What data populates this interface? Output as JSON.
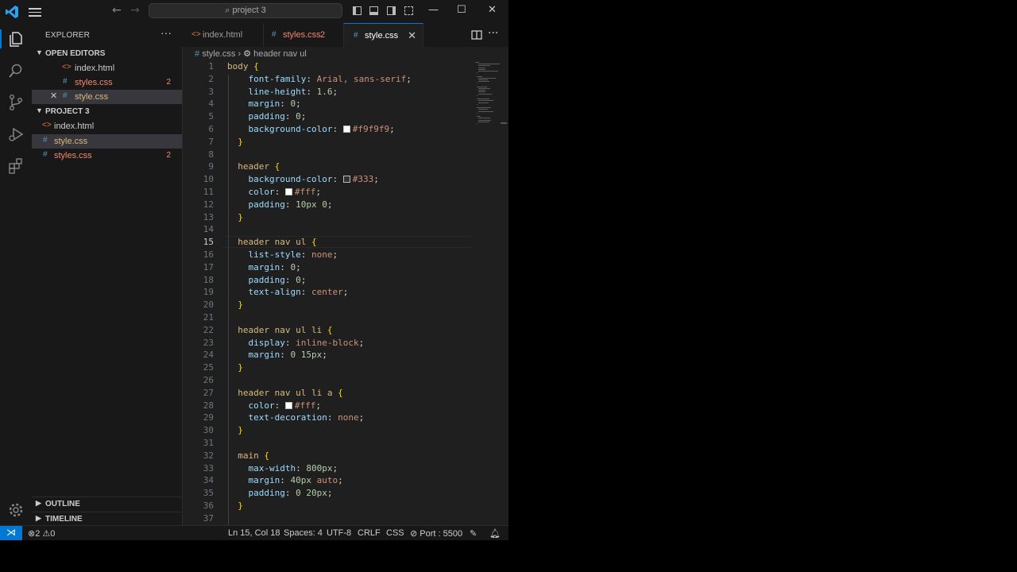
{
  "titlebar": {
    "search_text": "project 3",
    "back_arrow": "←",
    "forward_arrow": "→"
  },
  "sidebar": {
    "title": "EXPLORER",
    "more": "···",
    "open_editors_label": "OPEN EDITORS",
    "open_editors": [
      {
        "icon": "<>",
        "name": "index.html",
        "badge": ""
      },
      {
        "icon": "#",
        "name": "styles.css",
        "badge": "2"
      },
      {
        "icon": "#",
        "name": "style.css",
        "badge": "",
        "close": "✕"
      }
    ],
    "project_label": "PROJECT 3",
    "files": [
      {
        "icon": "<>",
        "name": "index.html",
        "badge": ""
      },
      {
        "icon": "#",
        "name": "style.css",
        "badge": ""
      },
      {
        "icon": "#",
        "name": "styles.css",
        "badge": "2"
      }
    ],
    "outline_label": "OUTLINE",
    "timeline_label": "TIMELINE"
  },
  "tabs": [
    {
      "icon": "<>",
      "name": "index.html",
      "extra": ""
    },
    {
      "icon": "#",
      "name": "styles.css",
      "extra": "2"
    },
    {
      "icon": "#",
      "name": "style.css",
      "extra": "✕"
    }
  ],
  "breadcrumb": {
    "file_icon": "#",
    "file": "style.css",
    "separator": "›",
    "symbol_icon": "⚙",
    "symbol": "header nav ul"
  },
  "editor": {
    "current_line": 15,
    "lines": [
      {
        "n": "1"
      },
      {
        "n": "2"
      },
      {
        "n": "3"
      },
      {
        "n": "4"
      },
      {
        "n": "5"
      },
      {
        "n": "6"
      },
      {
        "n": "7"
      },
      {
        "n": "8"
      },
      {
        "n": "9"
      },
      {
        "n": "10"
      },
      {
        "n": "11"
      },
      {
        "n": "12"
      },
      {
        "n": "13"
      },
      {
        "n": "14"
      },
      {
        "n": "15"
      },
      {
        "n": "16"
      },
      {
        "n": "17"
      },
      {
        "n": "18"
      },
      {
        "n": "19"
      },
      {
        "n": "20"
      },
      {
        "n": "21"
      },
      {
        "n": "22"
      },
      {
        "n": "23"
      },
      {
        "n": "24"
      },
      {
        "n": "25"
      },
      {
        "n": "26"
      },
      {
        "n": "27"
      },
      {
        "n": "28"
      },
      {
        "n": "29"
      },
      {
        "n": "30"
      },
      {
        "n": "31"
      },
      {
        "n": "32"
      },
      {
        "n": "33"
      },
      {
        "n": "34"
      },
      {
        "n": "35"
      },
      {
        "n": "36"
      },
      {
        "n": "37"
      }
    ],
    "code": [
      {
        "indent": "",
        "parts": [
          {
            "t": "body ",
            "c": "sel"
          },
          {
            "t": "{",
            "c": "br"
          }
        ]
      },
      {
        "indent": "    ",
        "parts": [
          {
            "t": "font-family",
            "c": "pr"
          },
          {
            "t": ": "
          },
          {
            "t": "Arial, sans-serif",
            "c": "vs"
          },
          {
            "t": ";"
          }
        ]
      },
      {
        "indent": "    ",
        "parts": [
          {
            "t": "line-height",
            "c": "pr"
          },
          {
            "t": ": "
          },
          {
            "t": "1.6",
            "c": "num"
          },
          {
            "t": ";"
          }
        ]
      },
      {
        "indent": "    ",
        "parts": [
          {
            "t": "margin",
            "c": "pr"
          },
          {
            "t": ": "
          },
          {
            "t": "0",
            "c": "num"
          },
          {
            "t": ";"
          }
        ]
      },
      {
        "indent": "    ",
        "parts": [
          {
            "t": "padding",
            "c": "pr"
          },
          {
            "t": ": "
          },
          {
            "t": "0",
            "c": "num"
          },
          {
            "t": ";"
          }
        ]
      },
      {
        "indent": "    ",
        "parts": [
          {
            "t": "background-color",
            "c": "pr"
          },
          {
            "t": ": "
          },
          {
            "swatch": "#f9f9f9"
          },
          {
            "t": "#f9f9f9",
            "c": "vs"
          },
          {
            "t": ";"
          }
        ]
      },
      {
        "indent": "  ",
        "parts": [
          {
            "t": "}",
            "c": "br"
          }
        ]
      },
      {
        "indent": "",
        "parts": []
      },
      {
        "indent": "  ",
        "parts": [
          {
            "t": "header ",
            "c": "sel"
          },
          {
            "t": "{",
            "c": "br"
          }
        ]
      },
      {
        "indent": "    ",
        "parts": [
          {
            "t": "background-color",
            "c": "pr"
          },
          {
            "t": ": "
          },
          {
            "swatch": "#333333"
          },
          {
            "t": "#333",
            "c": "vs"
          },
          {
            "t": ";"
          }
        ]
      },
      {
        "indent": "    ",
        "parts": [
          {
            "t": "color",
            "c": "pr"
          },
          {
            "t": ": "
          },
          {
            "swatch": "#ffffff"
          },
          {
            "t": "#fff",
            "c": "vs"
          },
          {
            "t": ";"
          }
        ]
      },
      {
        "indent": "    ",
        "parts": [
          {
            "t": "padding",
            "c": "pr"
          },
          {
            "t": ": "
          },
          {
            "t": "10px 0",
            "c": "num"
          },
          {
            "t": ";"
          }
        ]
      },
      {
        "indent": "  ",
        "parts": [
          {
            "t": "}",
            "c": "br"
          }
        ]
      },
      {
        "indent": "",
        "parts": []
      },
      {
        "indent": "  ",
        "parts": [
          {
            "t": "header nav ul ",
            "c": "sel"
          },
          {
            "t": "{",
            "c": "br"
          }
        ]
      },
      {
        "indent": "    ",
        "parts": [
          {
            "t": "list-style",
            "c": "pr"
          },
          {
            "t": ": "
          },
          {
            "t": "none",
            "c": "vs"
          },
          {
            "t": ";"
          }
        ]
      },
      {
        "indent": "    ",
        "parts": [
          {
            "t": "margin",
            "c": "pr"
          },
          {
            "t": ": "
          },
          {
            "t": "0",
            "c": "num"
          },
          {
            "t": ";"
          }
        ]
      },
      {
        "indent": "    ",
        "parts": [
          {
            "t": "padding",
            "c": "pr"
          },
          {
            "t": ": "
          },
          {
            "t": "0",
            "c": "num"
          },
          {
            "t": ";"
          }
        ]
      },
      {
        "indent": "    ",
        "parts": [
          {
            "t": "text-align",
            "c": "pr"
          },
          {
            "t": ": "
          },
          {
            "t": "center",
            "c": "vs"
          },
          {
            "t": ";"
          }
        ]
      },
      {
        "indent": "  ",
        "parts": [
          {
            "t": "}",
            "c": "br"
          }
        ]
      },
      {
        "indent": "",
        "parts": []
      },
      {
        "indent": "  ",
        "parts": [
          {
            "t": "header nav ul li ",
            "c": "sel"
          },
          {
            "t": "{",
            "c": "br"
          }
        ]
      },
      {
        "indent": "    ",
        "parts": [
          {
            "t": "display",
            "c": "pr"
          },
          {
            "t": ": "
          },
          {
            "t": "inline-block",
            "c": "vs"
          },
          {
            "t": ";"
          }
        ]
      },
      {
        "indent": "    ",
        "parts": [
          {
            "t": "margin",
            "c": "pr"
          },
          {
            "t": ": "
          },
          {
            "t": "0 15px",
            "c": "num"
          },
          {
            "t": ";"
          }
        ]
      },
      {
        "indent": "  ",
        "parts": [
          {
            "t": "}",
            "c": "br"
          }
        ]
      },
      {
        "indent": "",
        "parts": []
      },
      {
        "indent": "  ",
        "parts": [
          {
            "t": "header nav ul li a ",
            "c": "sel"
          },
          {
            "t": "{",
            "c": "br"
          }
        ]
      },
      {
        "indent": "    ",
        "parts": [
          {
            "t": "color",
            "c": "pr"
          },
          {
            "t": ": "
          },
          {
            "swatch": "#ffffff"
          },
          {
            "t": "#fff",
            "c": "vs"
          },
          {
            "t": ";"
          }
        ]
      },
      {
        "indent": "    ",
        "parts": [
          {
            "t": "text-decoration",
            "c": "pr"
          },
          {
            "t": ": "
          },
          {
            "t": "none",
            "c": "vs"
          },
          {
            "t": ";"
          }
        ]
      },
      {
        "indent": "  ",
        "parts": [
          {
            "t": "}",
            "c": "br"
          }
        ]
      },
      {
        "indent": "",
        "parts": []
      },
      {
        "indent": "  ",
        "parts": [
          {
            "t": "main ",
            "c": "sel"
          },
          {
            "t": "{",
            "c": "br"
          }
        ]
      },
      {
        "indent": "    ",
        "parts": [
          {
            "t": "max-width",
            "c": "pr"
          },
          {
            "t": ": "
          },
          {
            "t": "800px",
            "c": "num"
          },
          {
            "t": ";"
          }
        ]
      },
      {
        "indent": "    ",
        "parts": [
          {
            "t": "margin",
            "c": "pr"
          },
          {
            "t": ": "
          },
          {
            "t": "40px ",
            "c": "num"
          },
          {
            "t": "auto",
            "c": "vs"
          },
          {
            "t": ";"
          }
        ]
      },
      {
        "indent": "    ",
        "parts": [
          {
            "t": "padding",
            "c": "pr"
          },
          {
            "t": ": "
          },
          {
            "t": "0 20px",
            "c": "num"
          },
          {
            "t": ";"
          }
        ]
      },
      {
        "indent": "  ",
        "parts": [
          {
            "t": "}",
            "c": "br"
          }
        ]
      },
      {
        "indent": "",
        "parts": []
      }
    ]
  },
  "statusbar": {
    "errors": "2",
    "warnings": "0",
    "position": "Ln 15, Col 18",
    "spaces": "Spaces: 4",
    "encoding": "UTF-8",
    "eol": "CRLF",
    "language": "CSS",
    "port": "Port : 5500"
  },
  "colors": {
    "accent": "#0078d4",
    "editor_bg": "#1f1f1f",
    "sidebar_bg": "#181818",
    "error": "#f48771"
  }
}
